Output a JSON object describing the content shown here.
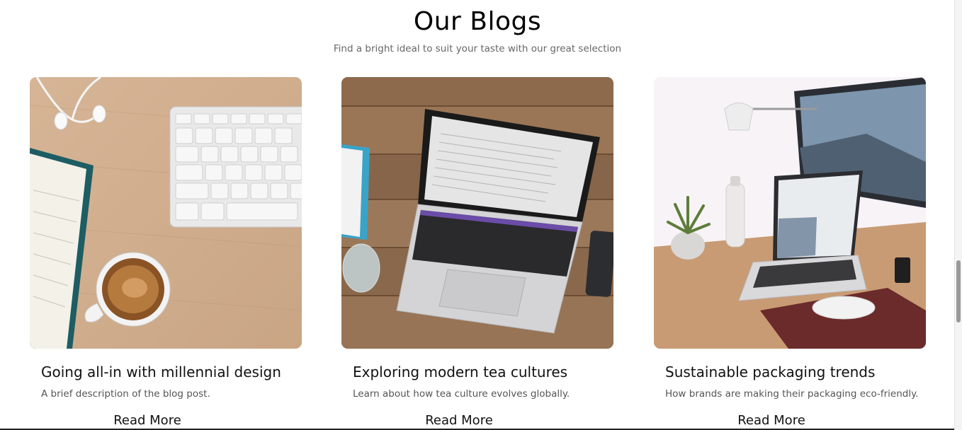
{
  "section": {
    "title": "Our Blogs",
    "subtitle": "Find a bright ideal to suit your taste with our great selection"
  },
  "posts": [
    {
      "title": "Going all-in with millennial design",
      "description": "A brief description of the blog post.",
      "cta": "Read More",
      "image": "keyboard-coffee-earphones-photo"
    },
    {
      "title": "Exploring modern tea cultures",
      "description": "Learn about how tea culture evolves globally.",
      "cta": "Read More",
      "image": "laptop-on-wooden-table-photo"
    },
    {
      "title": "Sustainable packaging trends",
      "description": "How brands are making their packaging eco-friendly.",
      "cta": "Read More",
      "image": "desk-workspace-monitor-laptop-photo"
    }
  ],
  "colors": {
    "title": "#000000",
    "subtitle": "#666666",
    "card_title": "#111111",
    "card_desc": "#555555"
  }
}
